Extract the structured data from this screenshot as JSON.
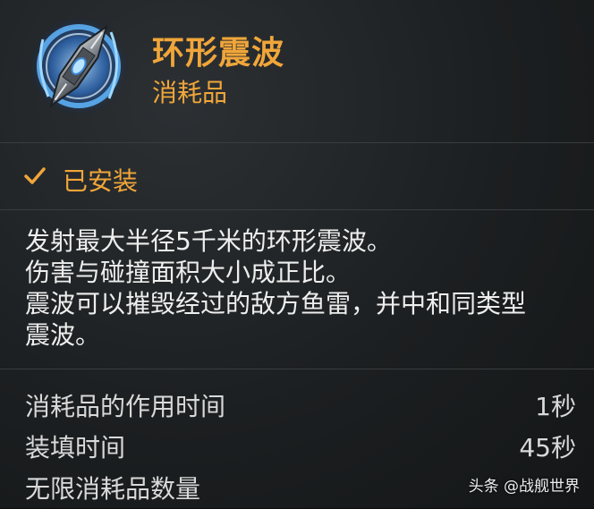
{
  "item": {
    "name": "环形震波",
    "type": "消耗品",
    "icon": "shockwave-consumable-icon"
  },
  "status": {
    "icon": "checkmark-icon",
    "label": "已安装"
  },
  "description": {
    "lines": [
      "发射最大半径5千米的环形震波。",
      "伤害与碰撞面积大小成正比。",
      "震波可以摧毁经过的敌方鱼雷，并中和同类型",
      "震波。"
    ]
  },
  "stats": [
    {
      "label": "消耗品的作用时间",
      "value": "1秒"
    },
    {
      "label": "装填时间",
      "value": "45秒"
    },
    {
      "label": "无限消耗品数量",
      "value": ""
    }
  ],
  "watermark": "头条 @战舰世界",
  "colors": {
    "accent": "#f0a63a",
    "text": "#eeeeee",
    "background": "#1c1f21",
    "divider": "#3a3d40"
  }
}
